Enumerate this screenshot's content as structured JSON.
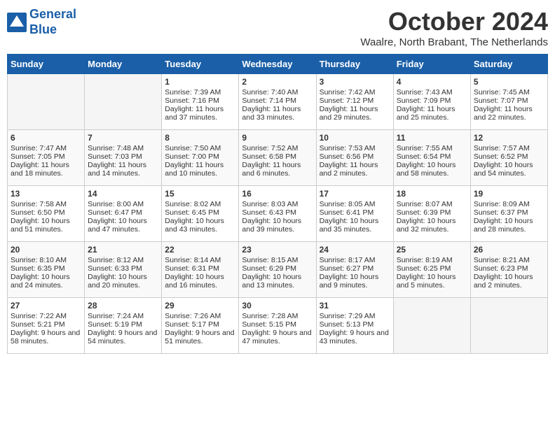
{
  "header": {
    "logo_line1": "General",
    "logo_line2": "Blue",
    "title": "October 2024",
    "location": "Waalre, North Brabant, The Netherlands"
  },
  "days_of_week": [
    "Sunday",
    "Monday",
    "Tuesday",
    "Wednesday",
    "Thursday",
    "Friday",
    "Saturday"
  ],
  "weeks": [
    [
      {
        "day": "",
        "content": ""
      },
      {
        "day": "",
        "content": ""
      },
      {
        "day": "1",
        "content": "Sunrise: 7:39 AM\nSunset: 7:16 PM\nDaylight: 11 hours and 37 minutes."
      },
      {
        "day": "2",
        "content": "Sunrise: 7:40 AM\nSunset: 7:14 PM\nDaylight: 11 hours and 33 minutes."
      },
      {
        "day": "3",
        "content": "Sunrise: 7:42 AM\nSunset: 7:12 PM\nDaylight: 11 hours and 29 minutes."
      },
      {
        "day": "4",
        "content": "Sunrise: 7:43 AM\nSunset: 7:09 PM\nDaylight: 11 hours and 25 minutes."
      },
      {
        "day": "5",
        "content": "Sunrise: 7:45 AM\nSunset: 7:07 PM\nDaylight: 11 hours and 22 minutes."
      }
    ],
    [
      {
        "day": "6",
        "content": "Sunrise: 7:47 AM\nSunset: 7:05 PM\nDaylight: 11 hours and 18 minutes."
      },
      {
        "day": "7",
        "content": "Sunrise: 7:48 AM\nSunset: 7:03 PM\nDaylight: 11 hours and 14 minutes."
      },
      {
        "day": "8",
        "content": "Sunrise: 7:50 AM\nSunset: 7:00 PM\nDaylight: 11 hours and 10 minutes."
      },
      {
        "day": "9",
        "content": "Sunrise: 7:52 AM\nSunset: 6:58 PM\nDaylight: 11 hours and 6 minutes."
      },
      {
        "day": "10",
        "content": "Sunrise: 7:53 AM\nSunset: 6:56 PM\nDaylight: 11 hours and 2 minutes."
      },
      {
        "day": "11",
        "content": "Sunrise: 7:55 AM\nSunset: 6:54 PM\nDaylight: 10 hours and 58 minutes."
      },
      {
        "day": "12",
        "content": "Sunrise: 7:57 AM\nSunset: 6:52 PM\nDaylight: 10 hours and 54 minutes."
      }
    ],
    [
      {
        "day": "13",
        "content": "Sunrise: 7:58 AM\nSunset: 6:50 PM\nDaylight: 10 hours and 51 minutes."
      },
      {
        "day": "14",
        "content": "Sunrise: 8:00 AM\nSunset: 6:47 PM\nDaylight: 10 hours and 47 minutes."
      },
      {
        "day": "15",
        "content": "Sunrise: 8:02 AM\nSunset: 6:45 PM\nDaylight: 10 hours and 43 minutes."
      },
      {
        "day": "16",
        "content": "Sunrise: 8:03 AM\nSunset: 6:43 PM\nDaylight: 10 hours and 39 minutes."
      },
      {
        "day": "17",
        "content": "Sunrise: 8:05 AM\nSunset: 6:41 PM\nDaylight: 10 hours and 35 minutes."
      },
      {
        "day": "18",
        "content": "Sunrise: 8:07 AM\nSunset: 6:39 PM\nDaylight: 10 hours and 32 minutes."
      },
      {
        "day": "19",
        "content": "Sunrise: 8:09 AM\nSunset: 6:37 PM\nDaylight: 10 hours and 28 minutes."
      }
    ],
    [
      {
        "day": "20",
        "content": "Sunrise: 8:10 AM\nSunset: 6:35 PM\nDaylight: 10 hours and 24 minutes."
      },
      {
        "day": "21",
        "content": "Sunrise: 8:12 AM\nSunset: 6:33 PM\nDaylight: 10 hours and 20 minutes."
      },
      {
        "day": "22",
        "content": "Sunrise: 8:14 AM\nSunset: 6:31 PM\nDaylight: 10 hours and 16 minutes."
      },
      {
        "day": "23",
        "content": "Sunrise: 8:15 AM\nSunset: 6:29 PM\nDaylight: 10 hours and 13 minutes."
      },
      {
        "day": "24",
        "content": "Sunrise: 8:17 AM\nSunset: 6:27 PM\nDaylight: 10 hours and 9 minutes."
      },
      {
        "day": "25",
        "content": "Sunrise: 8:19 AM\nSunset: 6:25 PM\nDaylight: 10 hours and 5 minutes."
      },
      {
        "day": "26",
        "content": "Sunrise: 8:21 AM\nSunset: 6:23 PM\nDaylight: 10 hours and 2 minutes."
      }
    ],
    [
      {
        "day": "27",
        "content": "Sunrise: 7:22 AM\nSunset: 5:21 PM\nDaylight: 9 hours and 58 minutes."
      },
      {
        "day": "28",
        "content": "Sunrise: 7:24 AM\nSunset: 5:19 PM\nDaylight: 9 hours and 54 minutes."
      },
      {
        "day": "29",
        "content": "Sunrise: 7:26 AM\nSunset: 5:17 PM\nDaylight: 9 hours and 51 minutes."
      },
      {
        "day": "30",
        "content": "Sunrise: 7:28 AM\nSunset: 5:15 PM\nDaylight: 9 hours and 47 minutes."
      },
      {
        "day": "31",
        "content": "Sunrise: 7:29 AM\nSunset: 5:13 PM\nDaylight: 9 hours and 43 minutes."
      },
      {
        "day": "",
        "content": ""
      },
      {
        "day": "",
        "content": ""
      }
    ]
  ]
}
